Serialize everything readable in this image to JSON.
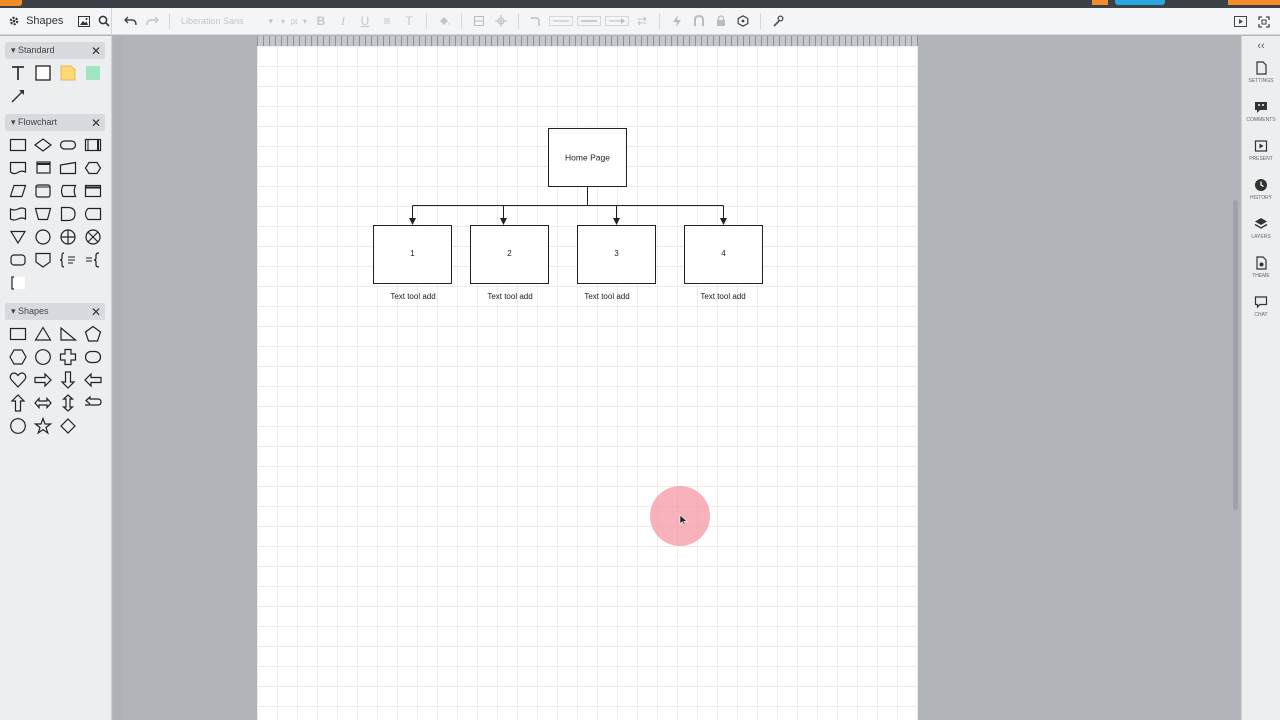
{
  "toolbar": {
    "shapes_label": "Shapes",
    "font_family": "Liberation Sans",
    "font_size": "pt"
  },
  "left_panel": {
    "sections": [
      {
        "title": "Standard"
      },
      {
        "title": "Flowchart"
      },
      {
        "title": "Shapes"
      }
    ]
  },
  "diagram": {
    "root": {
      "label": "Home Page"
    },
    "children": [
      {
        "label": "1",
        "caption": "Text tool add"
      },
      {
        "label": "2",
        "caption": "Text tool add"
      },
      {
        "label": "3",
        "caption": "Text tool add"
      },
      {
        "label": "4",
        "caption": "Text tool add"
      }
    ]
  },
  "right_panel": {
    "items": [
      {
        "label": "SETTINGS",
        "icon": "page-icon"
      },
      {
        "label": "COMMENTS",
        "icon": "comment-icon"
      },
      {
        "label": "PRESENT",
        "icon": "present-icon"
      },
      {
        "label": "HISTORY",
        "icon": "clock-icon"
      },
      {
        "label": "LAYERS",
        "icon": "layers-icon"
      },
      {
        "label": "THEME",
        "icon": "theme-icon"
      },
      {
        "label": "CHAT",
        "icon": "chat-icon"
      }
    ]
  },
  "colors": {
    "accent_orange": "#f28c28",
    "accent_blue": "#29a7e1",
    "cursor_highlight": "#f698a5"
  }
}
